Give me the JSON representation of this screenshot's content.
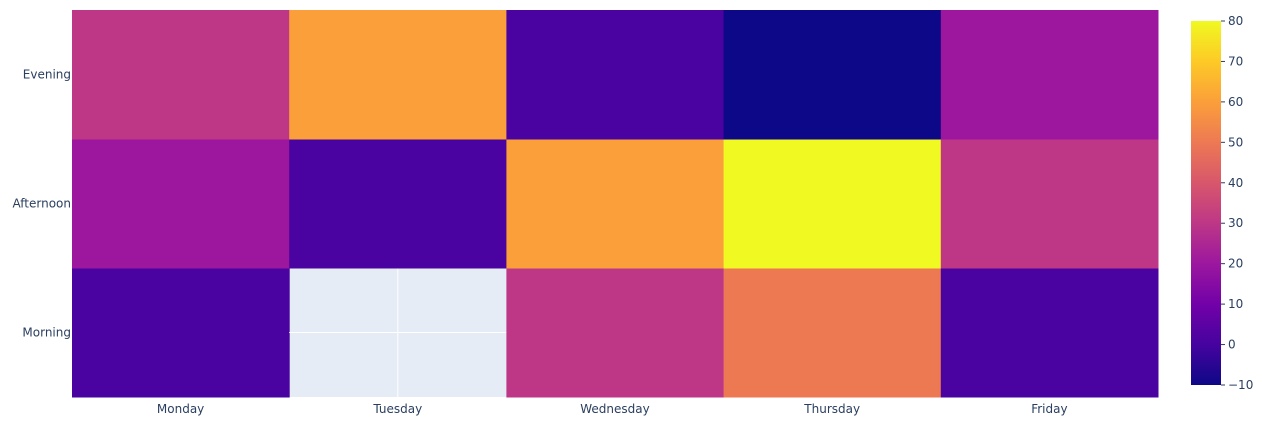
{
  "chart_data": {
    "type": "heatmap",
    "x": [
      "Monday",
      "Tuesday",
      "Wednesday",
      "Thursday",
      "Friday"
    ],
    "y": [
      "Morning",
      "Afternoon",
      "Evening"
    ],
    "z": [
      [
        1,
        null,
        30,
        50,
        1
      ],
      [
        20,
        1,
        60,
        80,
        30
      ],
      [
        30,
        60,
        1,
        -10,
        20
      ]
    ],
    "colorscale": "Plasma",
    "zmin": -10,
    "zmax": 80,
    "colorbar_ticks": [
      -10,
      0,
      10,
      20,
      30,
      40,
      50,
      60,
      70,
      80
    ],
    "missing_cell_color": "#E5ECF6"
  }
}
